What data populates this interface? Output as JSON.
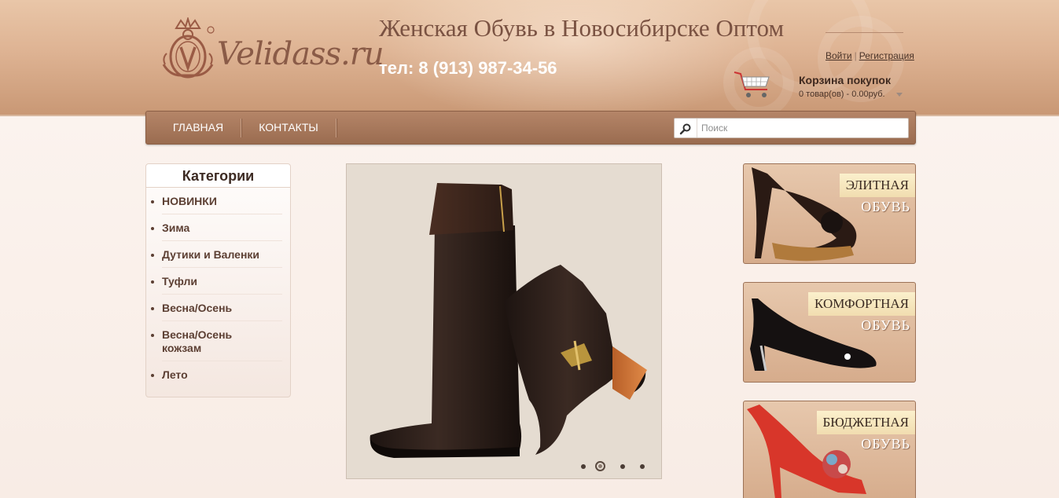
{
  "header": {
    "logo_text": "Velidass.ru",
    "site_title": "Женская Обувь в Новосибирске Оптом",
    "phone": "тел: 8 (913) 987-34-56",
    "login_label": "Войти",
    "auth_separator": "|",
    "register_label": "Регистрация"
  },
  "cart": {
    "title": "Корзина покупок",
    "summary": "0 товар(ов) - 0.00руб."
  },
  "nav": {
    "items": [
      {
        "label": "Главная"
      },
      {
        "label": "Контакты"
      }
    ]
  },
  "search": {
    "placeholder": "Поиск"
  },
  "categories": {
    "title": "Категории",
    "items": [
      {
        "label": "НОВИНКИ"
      },
      {
        "label": "Зима"
      },
      {
        "label": "Дутики и Валенки"
      },
      {
        "label": "Туфли"
      },
      {
        "label": "Весна/Осень"
      },
      {
        "label": "Весна/Осень кожзам"
      },
      {
        "label": "Лето"
      }
    ]
  },
  "slider": {
    "slide_count": 4,
    "active_slide": 2
  },
  "banners": [
    {
      "label": "Элитная",
      "sub": "обувь"
    },
    {
      "label": "Комфортная",
      "sub": "обувь"
    },
    {
      "label": "Бюджетная",
      "sub": "обувь"
    }
  ],
  "colors": {
    "header_bg": "#deb393",
    "nav_bg": "#a8795d",
    "text_brown": "#5c3f33",
    "banner_label_bg": "#f6e6be"
  }
}
